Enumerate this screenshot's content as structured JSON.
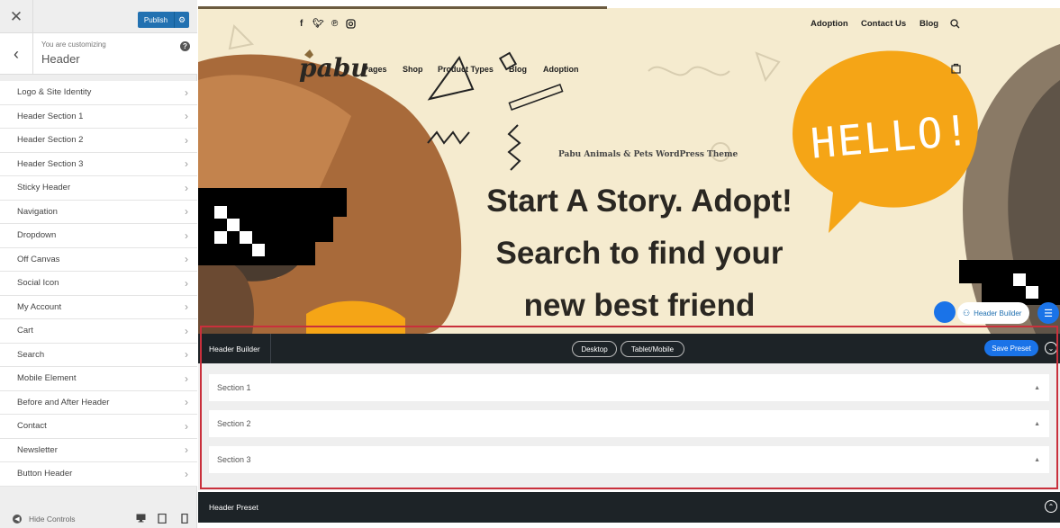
{
  "toolbar": {
    "close_glyph": "✕",
    "publish_label": "Publish",
    "publish_settings_glyph": "⚙"
  },
  "sidebar": {
    "back_glyph": "‹",
    "customizing_label": "You are customizing",
    "section_title": "Header",
    "help_glyph": "?",
    "items": [
      {
        "label": "Logo & Site Identity"
      },
      {
        "label": "Header Section 1"
      },
      {
        "label": "Header Section 2"
      },
      {
        "label": "Header Section 3"
      },
      {
        "label": "Sticky Header"
      },
      {
        "label": "Navigation"
      },
      {
        "label": "Dropdown"
      },
      {
        "label": "Off Canvas"
      },
      {
        "label": "Social Icon"
      },
      {
        "label": "My Account"
      },
      {
        "label": "Cart"
      },
      {
        "label": "Search"
      },
      {
        "label": "Mobile Element"
      },
      {
        "label": "Before and After Header"
      },
      {
        "label": "Contact"
      },
      {
        "label": "Newsletter"
      },
      {
        "label": "Button Header"
      }
    ],
    "footer": {
      "hide_controls_label": "Hide Controls",
      "devices": [
        "desktop-icon",
        "tablet-icon",
        "mobile-icon"
      ]
    }
  },
  "preview": {
    "social_icons": [
      "facebook-icon",
      "twitter-icon",
      "pinterest-icon",
      "instagram-icon"
    ],
    "top_nav": [
      "Adoption",
      "Contact Us",
      "Blog"
    ],
    "logo_text": "pabu",
    "main_nav": [
      "Pages",
      "Shop",
      "Product Types",
      "Blog",
      "Adoption"
    ],
    "tagline": "Pabu Animals & Pets WordPress Theme",
    "headline": [
      "Start A Story. Adopt!",
      "Search to find your",
      "new best friend"
    ],
    "speech_bubble_text": "HELLO!",
    "header_builder_pill": "Header Builder"
  },
  "builder": {
    "title": "Header Builder",
    "tabs": [
      "Desktop",
      "Tablet/Mobile"
    ],
    "save_preset_label": "Save Preset",
    "sections": [
      "Section 1",
      "Section 2",
      "Section 3"
    ],
    "preset_title": "Header Preset"
  },
  "colors": {
    "publish_blue": "#2271b1",
    "builder_dark": "#1d2327",
    "accent_blue": "#1a73e8",
    "highlight_red": "#c9303c",
    "hero_cream": "#f5ebcf",
    "bubble_orange": "#f5a516"
  }
}
